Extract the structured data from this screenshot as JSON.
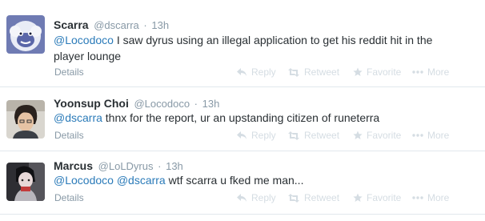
{
  "tweets": [
    {
      "fullname": "Scarra",
      "username": "@dscarra",
      "time": "13h",
      "mention": "@Locodoco",
      "text": " I saw dyrus using an illegal application to get his reddit hit in the player lounge",
      "details": "Details"
    },
    {
      "fullname": "Yoonsup Choi",
      "username": "@Locodoco",
      "time": "13h",
      "mention": "@dscarra",
      "text": " thnx for the report, ur an upstanding citizen of runeterra",
      "details": "Details"
    },
    {
      "fullname": "Marcus",
      "username": "@LoLDyrus",
      "time": "13h",
      "mention": "@Locodoco",
      "mention2": "@dscarra",
      "text": " wtf scarra u fked me man...",
      "details": "Details"
    }
  ],
  "actions": {
    "reply": "Reply",
    "retweet": "Retweet",
    "favorite": "Favorite",
    "more": "More"
  },
  "colors": {
    "link": "#2b7bb9",
    "muted": "#8899a6",
    "action": "#d5dde3",
    "divider": "#e1e8ed"
  }
}
